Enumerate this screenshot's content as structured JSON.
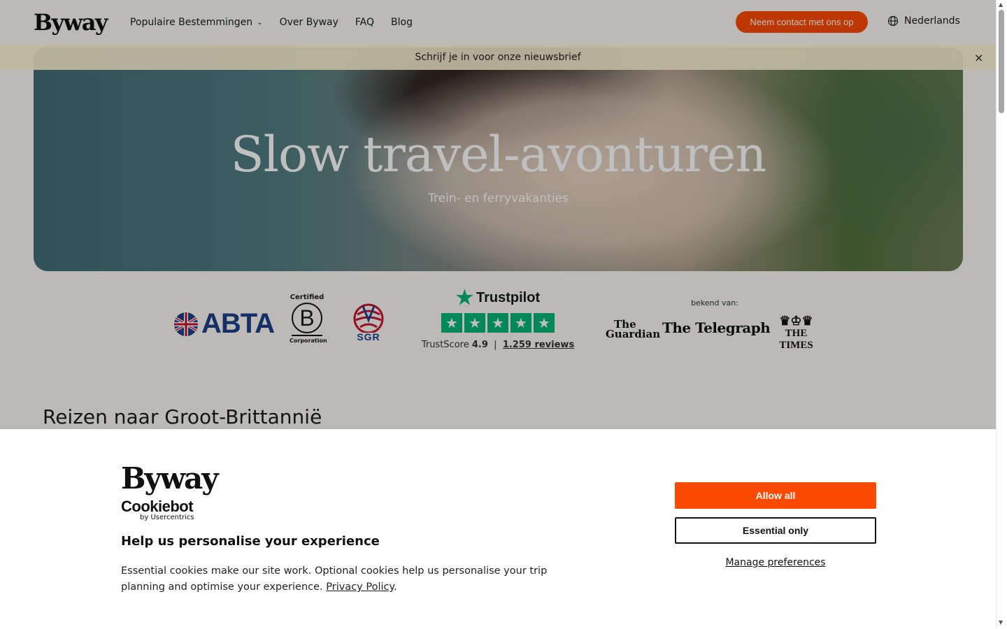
{
  "header": {
    "logo": "Byway",
    "nav": [
      {
        "label": "Populaire Bestemmingen",
        "has_dropdown": true
      },
      {
        "label": "Over Byway"
      },
      {
        "label": "FAQ"
      },
      {
        "label": "Blog"
      }
    ],
    "contact_label": "Neem contact met ons op",
    "language": "Nederlands"
  },
  "newsletter": {
    "text": "Schrijf je in voor onze nieuwsbrief",
    "close_icon": "×"
  },
  "hero": {
    "title": "Slow travel-avonturen",
    "subtitle": "Trein- en ferryvakanties"
  },
  "trust": {
    "abta": "ABTA",
    "bcorp_certified": "Certified",
    "bcorp_letter": "B",
    "bcorp_corporation": "Corporation",
    "sgr": "SGR",
    "trustpilot_brand": "Trustpilot",
    "trustscore_label": "TrustScore",
    "trustscore_value": "4.9",
    "separator": "|",
    "reviews_link": "1.259 reviews",
    "stars": 5,
    "press_label": "bekend van:",
    "press": {
      "guardian_line1": "The",
      "guardian_line2": "Guardian",
      "telegraph": "The Telegraph",
      "times": "THE TIMES"
    }
  },
  "section": {
    "title": "Reizen naar Groot-Brittannië"
  },
  "cookie_banner": {
    "logo": "Byway",
    "cookiebot": "Cookiebot",
    "cookiebot_by": "by Usercentrics",
    "heading": "Help us personalise your experience",
    "text": "Essential cookies make our site work. Optional cookies help us personalise your trip planning and optimise your experience.",
    "privacy_link": "Privacy Policy",
    "period": ".",
    "allow_all": "Allow all",
    "essential_only": "Essential only",
    "manage_preferences": "Manage preferences"
  },
  "colors": {
    "accent": "#fb4b01",
    "trustpilot_green": "#00b67a",
    "newsletter_bg": "#fff5d6",
    "page_bg": "#fbf9f4"
  },
  "icons": {
    "chevron": "chevron-down-icon",
    "globe": "globe-icon",
    "close": "close-icon",
    "star": "star-icon"
  }
}
